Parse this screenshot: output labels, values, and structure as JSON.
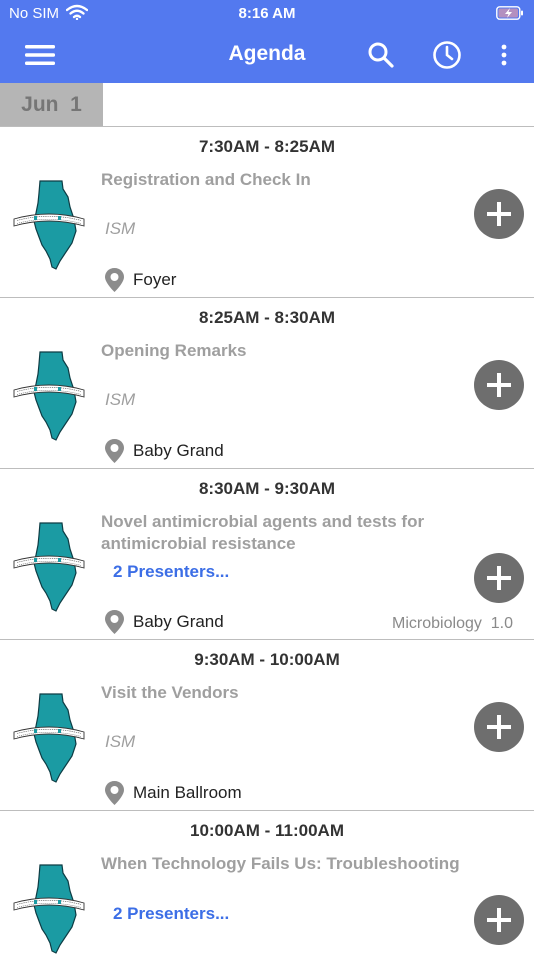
{
  "status": {
    "carrier": "No SIM",
    "time": "8:16 AM"
  },
  "nav": {
    "title": "Agenda",
    "accent": "#5379ef"
  },
  "date_label": "Jun  1",
  "sessions": [
    {
      "time": "7:30AM - 8:25AM",
      "title": "Registration and Check In",
      "org": "ISM",
      "location": "Foyer"
    },
    {
      "time": "8:25AM - 8:30AM",
      "title": "Opening Remarks",
      "org": "ISM",
      "location": "Baby Grand"
    },
    {
      "time": "8:30AM - 9:30AM",
      "title": "Novel antimicrobial agents and tests for antimicrobial resistance",
      "presenters": "2 Presenters...",
      "location": "Baby Grand",
      "track": "Microbiology",
      "credits": "1.0"
    },
    {
      "time": "9:30AM - 10:00AM",
      "title": "Visit the Vendors",
      "org": "ISM",
      "location": "Main Ballroom"
    },
    {
      "time": "10:00AM - 11:00AM",
      "title": "When Technology Fails Us: Troubleshooting Instrumentation in the…",
      "presenters": "2 Presenters..."
    }
  ],
  "icons": {
    "menu": "hamburger-icon",
    "search": "search-icon",
    "clock": "clock-icon",
    "more": "more-vert-icon",
    "location": "location-pin-icon",
    "add": "plus-circle-icon",
    "logo": "illinois-society-logo"
  }
}
